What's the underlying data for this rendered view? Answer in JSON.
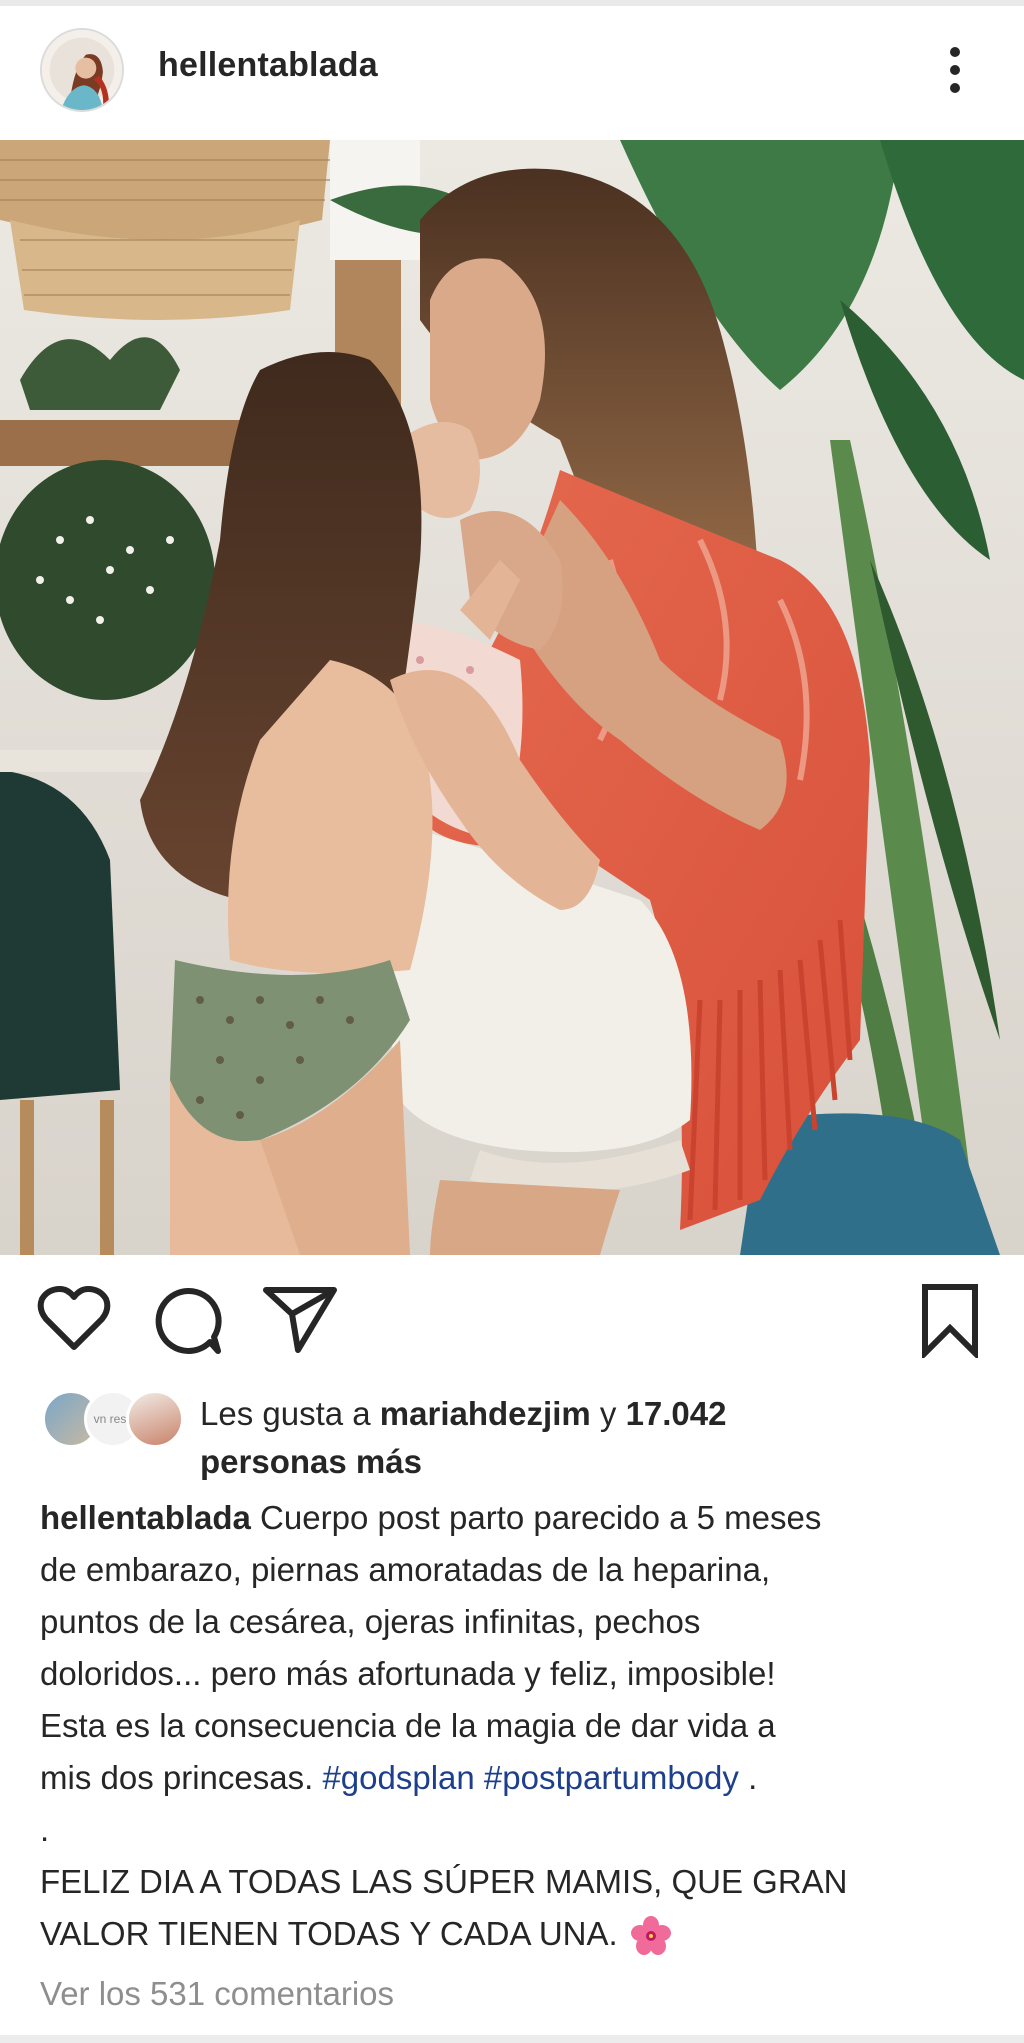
{
  "header": {
    "username": "hellentablada",
    "avatar_icon": "profile-photo",
    "more_icon": "more-vertical-icon"
  },
  "post": {
    "image_description_icon": "post-photo"
  },
  "actions": {
    "like_icon": "heart-icon",
    "comment_icon": "comment-bubble-icon",
    "share_icon": "paper-plane-icon",
    "save_icon": "bookmark-icon"
  },
  "likes": {
    "prefix": "Les gusta a ",
    "user": "mariahdezjim",
    "connector": " y ",
    "count": "17.042",
    "suffix": "personas más",
    "avatar_middle_text": "vn\nress"
  },
  "caption": {
    "author": "hellentablada",
    "line1_text": " Cuerpo post parto parecido a 5 meses",
    "line2": "de embarazo, piernas amoratadas de la heparina,",
    "line3": "puntos de la cesárea, ojeras infinitas, pechos",
    "line4": "doloridos... pero más afortunada y feliz, imposible!",
    "line5": "Esta es la consecuencia de la magia de dar vida a",
    "line6_text": "mis dos princesas. ",
    "hashtag1": "#godsplan",
    "hashtag2": "#postpartumbody",
    "line6_end": " .",
    "line7": ".",
    "line8": "FELIZ DIA A TODAS LAS SÚPER MAMIS, QUE GRAN",
    "line9": "VALOR TIENEN TODAS Y CADA UNA. ",
    "emoji_icon": "hibiscus-flower-icon"
  },
  "comments_link": "Ver los 531 comentarios",
  "colors": {
    "text": "#262626",
    "hashtag": "#1e3f8c",
    "muted": "#8e8e8e"
  }
}
